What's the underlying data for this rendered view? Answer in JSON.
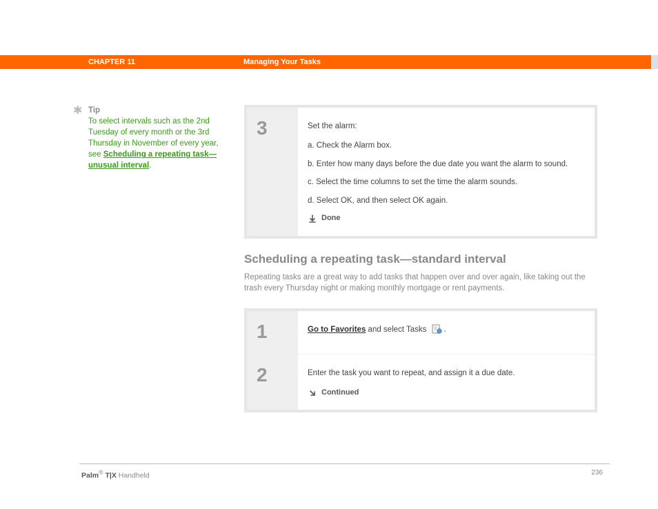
{
  "header": {
    "chapter": "CHAPTER 11",
    "section": "Managing Your Tasks"
  },
  "tip": {
    "label": "Tip",
    "text_before": "To select intervals such as the 2nd Tuesday of every month or the 3rd Thursday in November of every year, see ",
    "link_text": "Scheduling a repeating task—unusual interval",
    "text_after": "."
  },
  "step3": {
    "num": "3",
    "title": "Set the alarm:",
    "a": "a.  Check the Alarm box.",
    "b": "b.  Enter how many days before the due date you want the alarm to sound.",
    "c": "c.  Select the time columns to set the time the alarm sounds.",
    "d": "d.  Select OK, and then select OK again.",
    "done": "Done"
  },
  "section_heading": "Scheduling a repeating task—standard interval",
  "section_intro": "Repeating tasks are a great way to add tasks that happen over and over again, like taking out the trash every Thursday night or making monthly mortgage or rent payments.",
  "step1": {
    "num": "1",
    "link": "Go to Favorites",
    "rest": " and select Tasks "
  },
  "step2": {
    "num": "2",
    "text": "Enter the task you want to repeat, and assign it a due date.",
    "continued": "Continued"
  },
  "footer": {
    "brand_bold": "Palm",
    "reg": "®",
    "model": " T|X",
    "rest": " Handheld",
    "page": "236"
  }
}
